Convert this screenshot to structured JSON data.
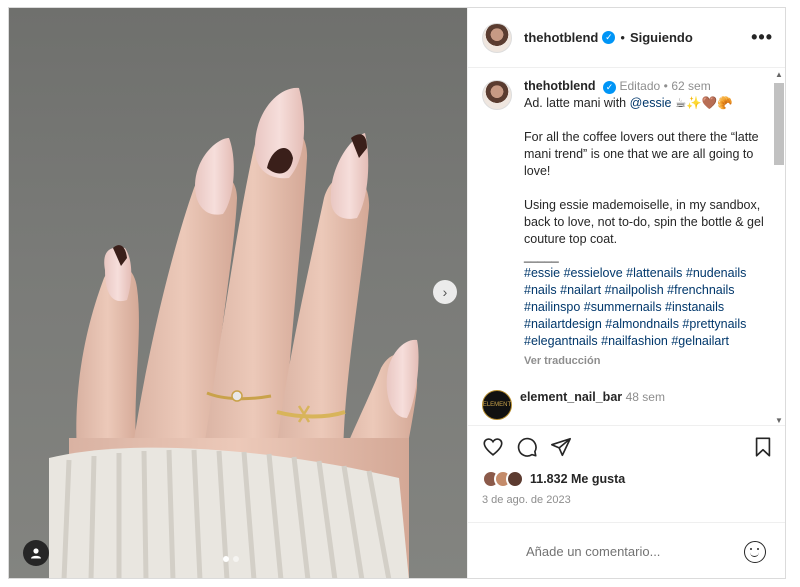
{
  "post": {
    "author": "thehotblend",
    "follow_sep": "•",
    "follow_label": "Siguiendo",
    "more_label": "•••"
  },
  "caption": {
    "author": "thehotblend",
    "edited": "Editado",
    "dot": "•",
    "age": "62 sem",
    "line1_prefix": "Ad. latte mani with ",
    "mention": "@essie",
    "line1_emojis": "☕✨🤎🥐",
    "para2": "For all the coffee lovers out there the “latte mani trend” is one that we are all going to love!",
    "para3": "Using essie mademoiselle, in my sandbox, back to love, not to-do, spin the bottle & gel couture top coat.",
    "divider": "_____",
    "hashtags": "#essie #essielove #lattenails #nudenails #nails #nailart #nailpolish #frenchnails #nailinspo #summernails #instanails #nailartdesign #almondnails #prettynails #elegantnails #nailfashion #gelnailart",
    "see_translation": "Ver traducción"
  },
  "comment": {
    "author": "element_nail_bar",
    "age": "48 sem",
    "avatar_text": "ELEMENT"
  },
  "actions": {
    "likes": "11.832 Me gusta",
    "date": "3 de ago. de 2023"
  },
  "add_comment": {
    "placeholder": "Añade un comentario..."
  },
  "carousel": {
    "next": "›",
    "current_index": 1,
    "total": 2
  },
  "colors": {
    "verified": "#0095f6",
    "link": "#00376b",
    "muted": "#8e8e8e"
  }
}
